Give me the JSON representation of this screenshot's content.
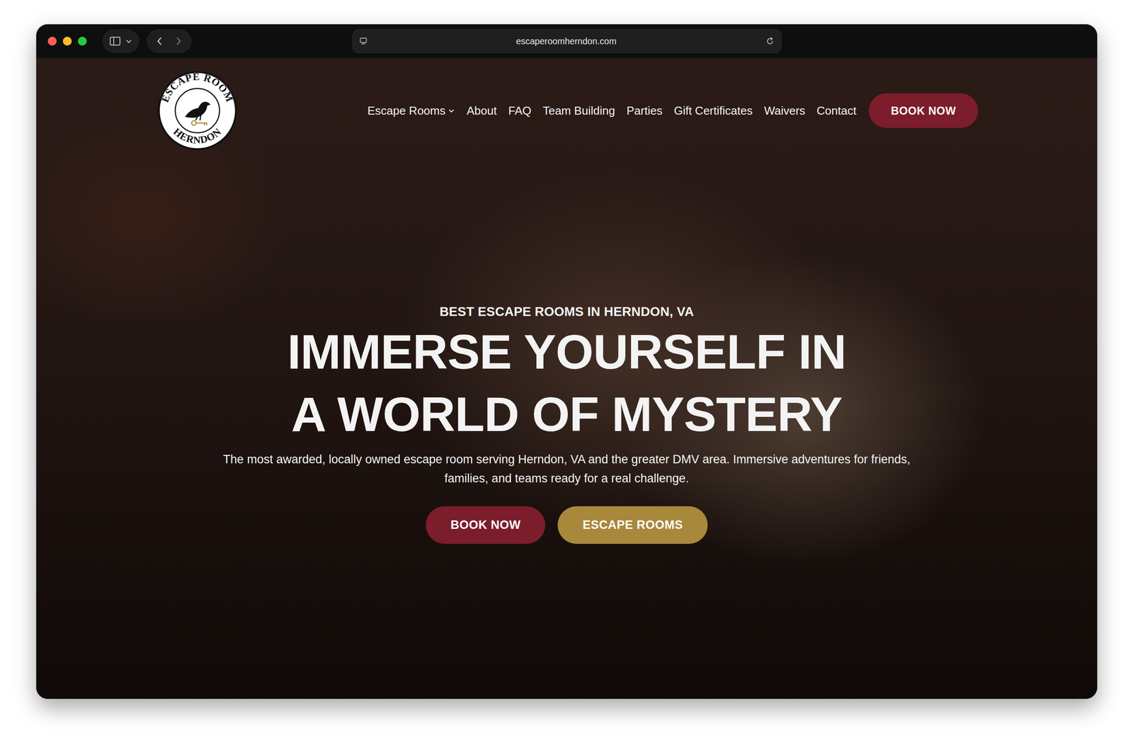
{
  "browser": {
    "url": "escaperoomherndon.com"
  },
  "logo": {
    "top": "ESCAPE ROOM",
    "bottom": "HERNDON"
  },
  "nav": {
    "items": [
      {
        "label": "Escape Rooms",
        "kind": "dropdown"
      },
      {
        "label": "About",
        "kind": "link"
      },
      {
        "label": "FAQ",
        "kind": "link"
      },
      {
        "label": "Team Building",
        "kind": "link"
      },
      {
        "label": "Parties",
        "kind": "link"
      },
      {
        "label": "Gift Certificates",
        "kind": "link"
      },
      {
        "label": "Waivers",
        "kind": "link"
      },
      {
        "label": "Contact",
        "kind": "link"
      }
    ],
    "cta": "BOOK NOW"
  },
  "hero": {
    "eyebrow": "BEST ESCAPE ROOMS IN HERNDON, VA",
    "title_lines": [
      "IMMERSE YOURSELF IN",
      "A WORLD OF MYSTERY"
    ],
    "subtitle": "The most awarded, locally owned escape room serving Herndon, VA and the greater DMV area. Immersive adventures for friends, families, and teams ready for a real challenge.",
    "buttons": [
      {
        "label": "BOOK NOW",
        "kind": "primary"
      },
      {
        "label": "ESCAPE ROOMS",
        "kind": "secondary"
      }
    ]
  }
}
